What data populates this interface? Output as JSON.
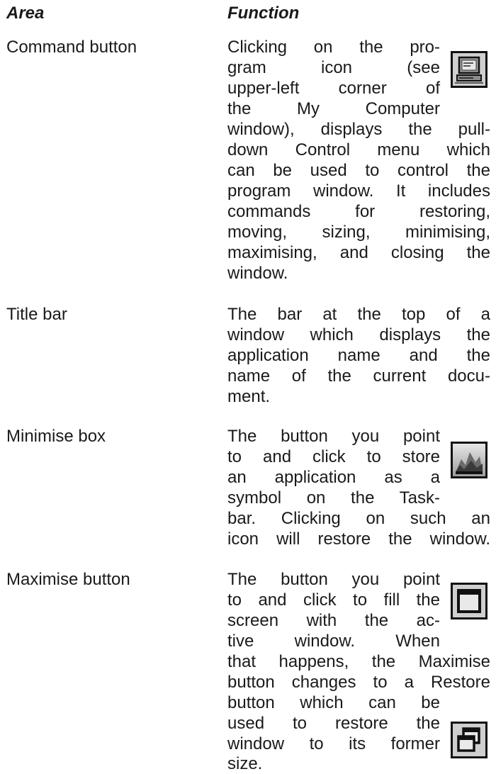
{
  "headers": {
    "area": "Area",
    "function": "Function"
  },
  "rows": [
    {
      "term": "Command button",
      "lines": [
        "Clicking on the pro-",
        "gram icon (see",
        "upper-left corner of",
        "the My Computer",
        "window), displays the pull-",
        "down Control menu which",
        "can be used to control the",
        "program window. It includes",
        "commands for restoring,",
        "moving, sizing, minimising,",
        "maximising, and closing the",
        "window."
      ]
    },
    {
      "term": "Title bar",
      "lines": [
        "The bar at the top of a",
        "window which displays the",
        "application name and the",
        "name of the current docu-",
        "ment."
      ]
    },
    {
      "term": "Minimise box",
      "lines": [
        "The button you point",
        "to and click to store",
        "an application as a",
        "symbol on the Task-",
        "bar. Clicking on such an",
        "icon will restore the window."
      ]
    },
    {
      "term": "Maximise button",
      "lines": [
        "The button you point",
        "to and click to fill the",
        "screen with the ac-",
        "tive window. When",
        "that happens, the Maximise",
        "button changes to a Restore",
        "button which can be",
        "used to restore the",
        "window to its former",
        "size."
      ]
    }
  ],
  "icons": [
    "computer-icon",
    "minimise-icon",
    "maximise-icon",
    "restore-icon"
  ]
}
